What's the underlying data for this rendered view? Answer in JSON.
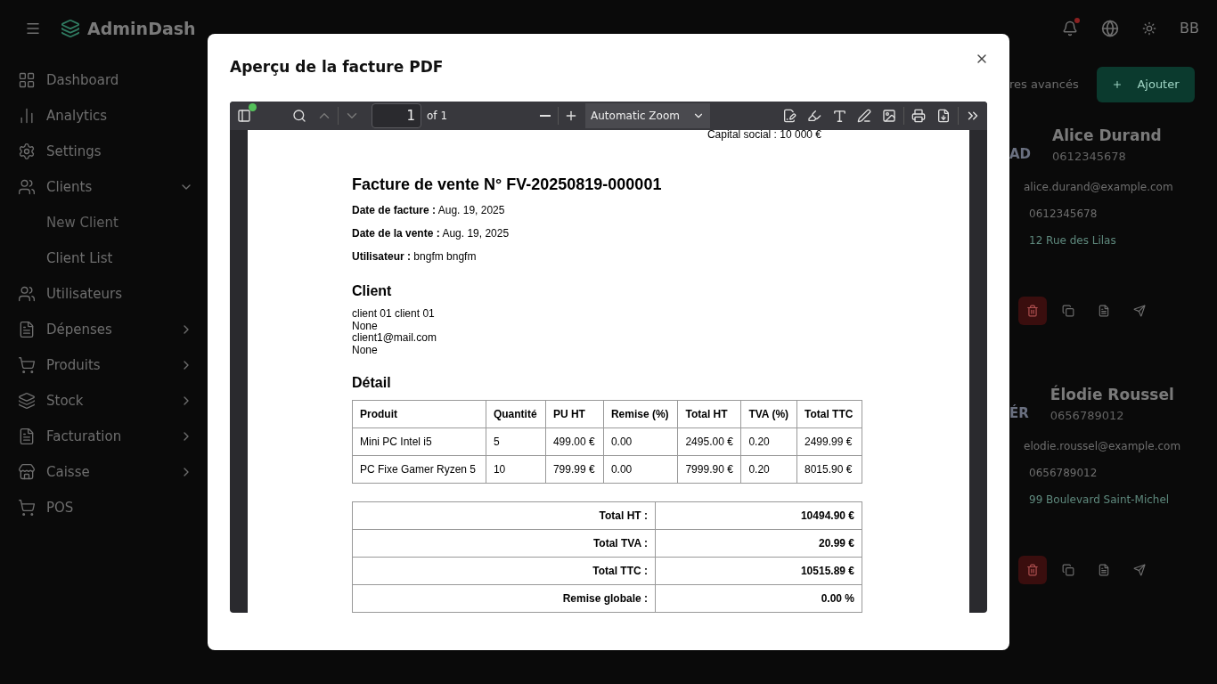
{
  "header": {
    "brand": "AdminDash",
    "notification": true,
    "avatar": "BB"
  },
  "sidebar": [
    {
      "kind": "link",
      "label": "Dashboard"
    },
    {
      "kind": "link",
      "label": "Analytics"
    },
    {
      "kind": "link",
      "label": "Settings"
    },
    {
      "kind": "group",
      "label": "Clients",
      "expanded": true,
      "children": [
        {
          "label": "New Client"
        },
        {
          "label": "Client List"
        }
      ]
    },
    {
      "kind": "link",
      "label": "Utilisateurs"
    },
    {
      "kind": "group",
      "label": "Dépenses",
      "expanded": false
    },
    {
      "kind": "group",
      "label": "Produits",
      "expanded": false
    },
    {
      "kind": "group",
      "label": "Stock",
      "expanded": false
    },
    {
      "kind": "group",
      "label": "Facturation",
      "expanded": false
    },
    {
      "kind": "group",
      "label": "Caisse",
      "expanded": false
    },
    {
      "kind": "link",
      "label": "POS"
    }
  ],
  "toolbar": {
    "filters_text": "res avancés",
    "add_button": "Ajouter"
  },
  "clients": [
    {
      "initials": "AD",
      "name": "Alice Durand",
      "subtitle": "0612345678",
      "email": "alice.durand@example.com",
      "phone": "0612345678",
      "address": "12 Rue des Lilas"
    },
    {
      "initials": "ÉR",
      "name": "Élodie Roussel",
      "subtitle": "0656789012",
      "email": "elodie.roussel@example.com",
      "phone": "0656789012",
      "address": "99 Boulevard Saint-Michel"
    }
  ],
  "dialog": {
    "title": "Aperçu de la facture PDF",
    "viewer": {
      "sidebar_notification": true,
      "page": "1",
      "page_count": "of 1",
      "zoom": "Automatic Zoom"
    },
    "invoice": {
      "company_line": "Capital social : 10 000 €",
      "title": "Facture de vente N° FV-20250819-000001",
      "meta": [
        {
          "label": "Date de facture :",
          "value": "Aug. 19, 2025"
        },
        {
          "label": "Date de la vente :",
          "value": "Aug. 19, 2025"
        },
        {
          "label": "Utilisateur :",
          "value": "bngfm bngfm"
        }
      ],
      "client_heading": "Client",
      "client_lines": [
        "client 01 client 01",
        "None",
        "client1@mail.com",
        "None"
      ],
      "detail_heading": "Détail",
      "columns": [
        "Produit",
        "Quantité",
        "PU HT",
        "Remise (%)",
        "Total HT",
        "TVA (%)",
        "Total TTC"
      ],
      "rows": [
        [
          "Mini PC Intel i5",
          "5",
          "499.00 €",
          "0.00",
          "2495.00 €",
          "0.20",
          "2499.99 €"
        ],
        [
          "PC Fixe Gamer Ryzen 5",
          "10",
          "799.99 €",
          "0.00",
          "7999.90 €",
          "0.20",
          "8015.90 €"
        ]
      ],
      "totals": [
        {
          "label": "Total HT :",
          "value": "10494.90 €"
        },
        {
          "label": "Total TVA :",
          "value": "20.99 €"
        },
        {
          "label": "Total TTC :",
          "value": "10515.89 €"
        },
        {
          "label": "Remise globale :",
          "value": "0.00 %"
        }
      ]
    }
  }
}
